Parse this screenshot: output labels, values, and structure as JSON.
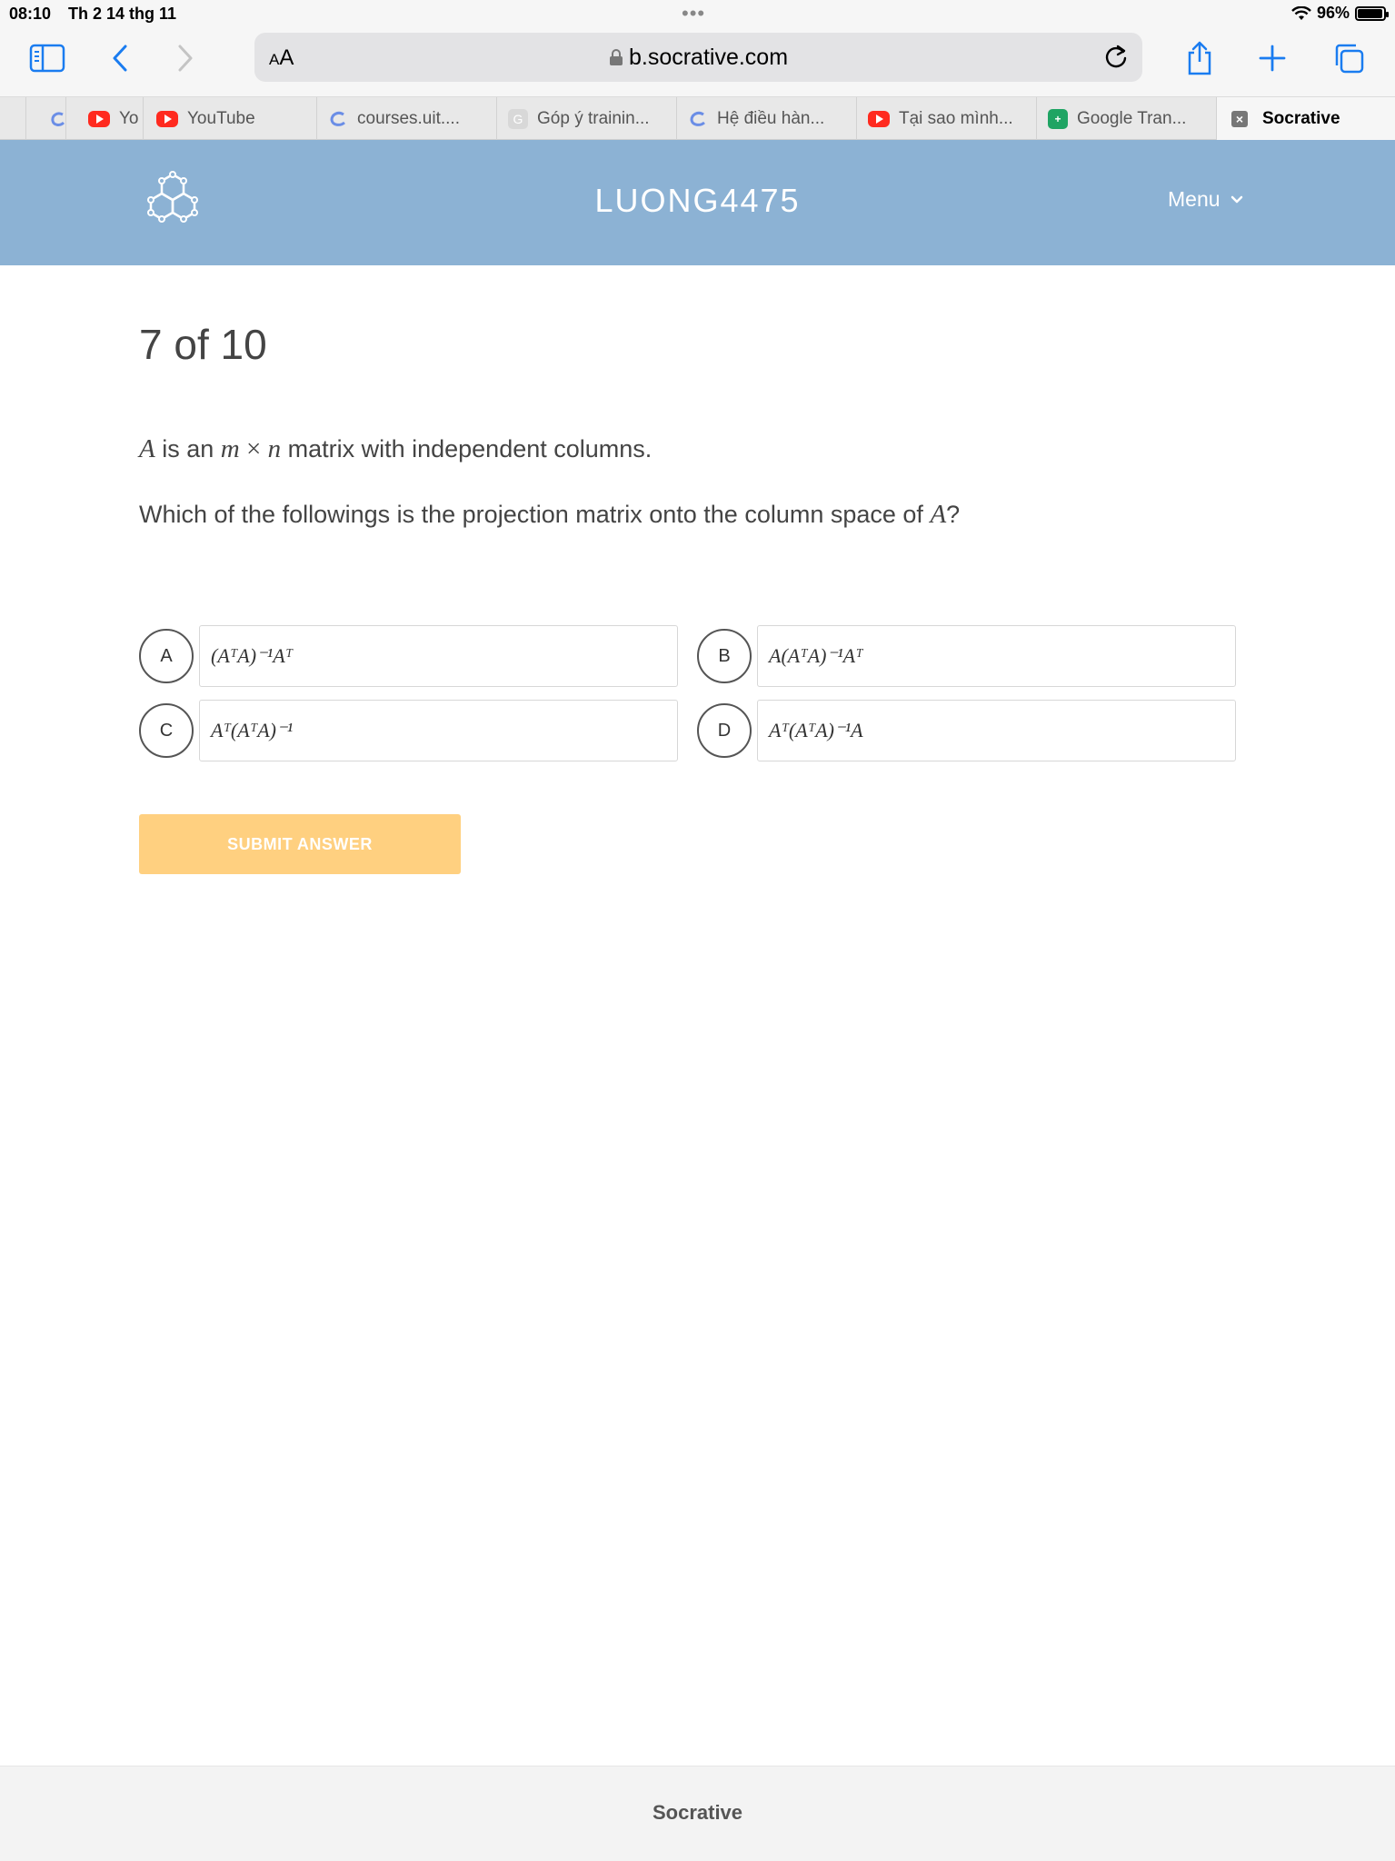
{
  "status_bar": {
    "time": "08:10",
    "date": "Th 2 14 thg 11",
    "battery_percent": "96%",
    "battery_level": 0.96
  },
  "browser": {
    "reader_label_small": "A",
    "reader_label_large": "A",
    "url": "b.socrative.com",
    "icons": [
      "sidebar-icon",
      "back-icon",
      "forward-icon",
      "lock-icon",
      "reload-icon",
      "share-icon",
      "new-tab-icon",
      "tabs-overview-icon"
    ]
  },
  "tabs": [
    {
      "label": "",
      "favicon": "courses-icon"
    },
    {
      "label": "Yo",
      "favicon": "youtube-icon"
    },
    {
      "label": "YouTube",
      "favicon": "youtube-icon"
    },
    {
      "label": "courses.uit....",
      "favicon": "courses-icon"
    },
    {
      "label": "Góp ý trainin...",
      "favicon": "google-icon"
    },
    {
      "label": "Hệ điều hàn...",
      "favicon": "courses-icon"
    },
    {
      "label": "Tại sao mình...",
      "favicon": "youtube-icon"
    },
    {
      "label": "Google Tran...",
      "favicon": "google-sheets-icon"
    },
    {
      "label": "Socrative",
      "favicon": "close-icon",
      "active": true
    }
  ],
  "header": {
    "room_name": "LUONG4475",
    "menu_label": "Menu",
    "color": "#8cb2d4"
  },
  "quiz": {
    "progress": "7 of 10",
    "question": {
      "line1": {
        "var_a": "A",
        "t1": " is an ",
        "m": "m",
        "times": " × ",
        "n": "n",
        "t2": " matrix with independent columns."
      },
      "line2": {
        "t1": "Which of the followings is the projection matrix onto the column space of ",
        "var_a": "A",
        "t2": "?"
      }
    },
    "options": [
      {
        "letter": "A",
        "text": "(AᵀA)⁻¹Aᵀ"
      },
      {
        "letter": "B",
        "text": "A(AᵀA)⁻¹Aᵀ"
      },
      {
        "letter": "C",
        "text": "Aᵀ(AᵀA)⁻¹"
      },
      {
        "letter": "D",
        "text": "Aᵀ(AᵀA)⁻¹A"
      }
    ],
    "submit_label": "SUBMIT ANSWER",
    "submit_color": "#ffd080"
  },
  "footer": {
    "label": "Socrative"
  }
}
